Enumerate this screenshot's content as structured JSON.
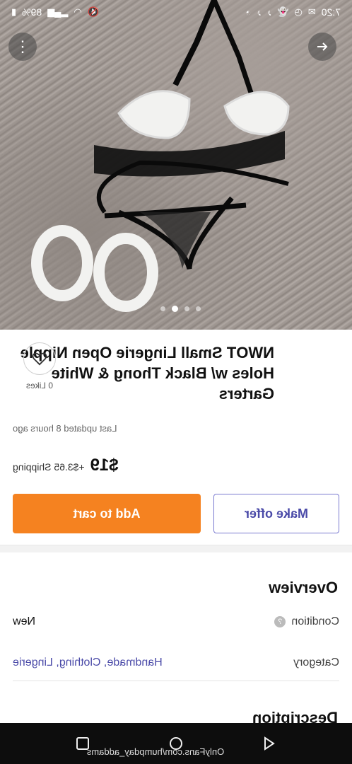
{
  "status": {
    "time": "7:20",
    "battery": "89%",
    "icons_right": [
      "clock-icon",
      "tiktok-icon",
      "tiktok-icon",
      "snapchat-icon",
      "timer-icon",
      "message-icon"
    ],
    "icons_left": [
      "battery-icon",
      "signal-icon",
      "wifi-icon",
      "mute-icon"
    ]
  },
  "listing": {
    "title": "NWOT Small Lingerie Open Nipple Holes w/ Black Thong & White Garters",
    "likes": "0 Likes",
    "updated": "Last updated 8 hours ago",
    "price": "$19",
    "shipping": "+$3.65 Shipping",
    "image_pages": 4,
    "image_active_index": 2
  },
  "buttons": {
    "add_to_cart": "Add to cart",
    "make_offer": "Make offer"
  },
  "overview": {
    "heading": "Overview",
    "condition_label": "Condition",
    "condition_value": "New",
    "category_label": "Category",
    "category_value": "Handmade, Clothing, Lingerie",
    "description_heading": "Description"
  },
  "navbar": {
    "watermark": "OnlyFans.com/humpday_addams"
  },
  "colors": {
    "accent_orange": "#f58220",
    "accent_purple": "#4a4aa8"
  }
}
